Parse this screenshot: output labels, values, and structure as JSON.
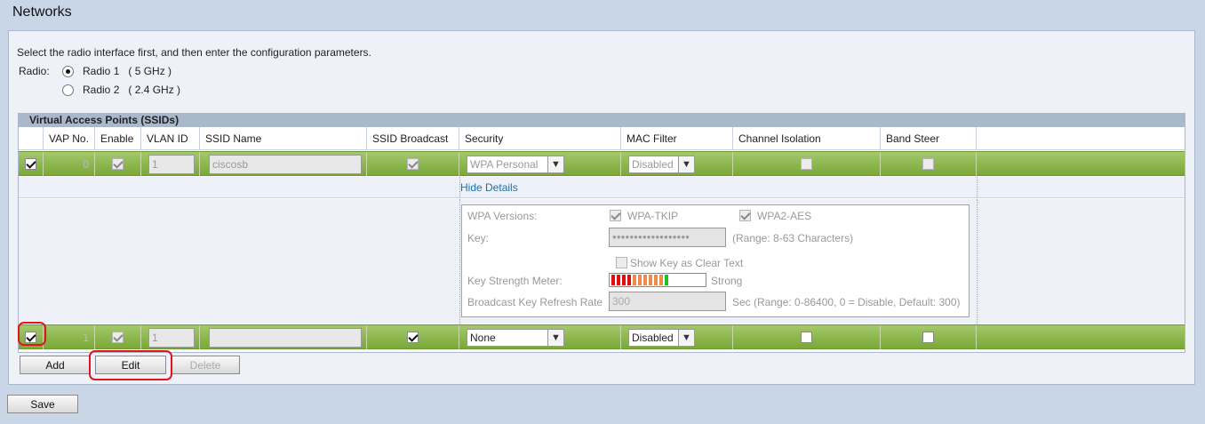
{
  "page": {
    "title": "Networks"
  },
  "intro": "Select the radio interface first, and then enter the configuration parameters.",
  "radio": {
    "label": "Radio:",
    "options": [
      {
        "label": "Radio 1   ( 5 GHz )",
        "selected": true
      },
      {
        "label": "Radio 2   ( 2.4 GHz )",
        "selected": false
      }
    ]
  },
  "table": {
    "title": "Virtual Access Points (SSIDs)",
    "headers": [
      "VAP No.",
      "Enable",
      "VLAN ID",
      "SSID Name",
      "SSID Broadcast",
      "Security",
      "MAC Filter",
      "Channel Isolation",
      "Band Steer"
    ],
    "rows": [
      {
        "vap": "0",
        "vlan": "1",
        "ssid": "ciscosb",
        "security": "WPA Personal",
        "mac_filter": "Disabled"
      },
      {
        "vap": "1",
        "vlan": "1",
        "ssid": "",
        "security": "None",
        "mac_filter": "Disabled"
      }
    ]
  },
  "details": {
    "link": "Hide Details",
    "wpa_versions_label": "WPA Versions:",
    "wpa_tkip": "WPA-TKIP",
    "wpa2_aes": "WPA2-AES",
    "key_label": "Key:",
    "key_value": "●●●●●●●●●●●●●●●●●●",
    "key_range": "(Range: 8-63 Characters)",
    "show_key": "Show Key as Clear Text",
    "strength_label": "Key Strength Meter:",
    "strength_value": "Strong",
    "refresh_label": "Broadcast Key Refresh Rate",
    "refresh_value": "300",
    "refresh_range": "Sec (Range: 0-86400, 0 = Disable, Default: 300)"
  },
  "buttons": {
    "add": "Add",
    "edit": "Edit",
    "delete": "Delete",
    "save": "Save"
  },
  "colors": {
    "row_green": "#8cb84a",
    "highlight": "#e0141c",
    "link": "#1a6fb0"
  }
}
